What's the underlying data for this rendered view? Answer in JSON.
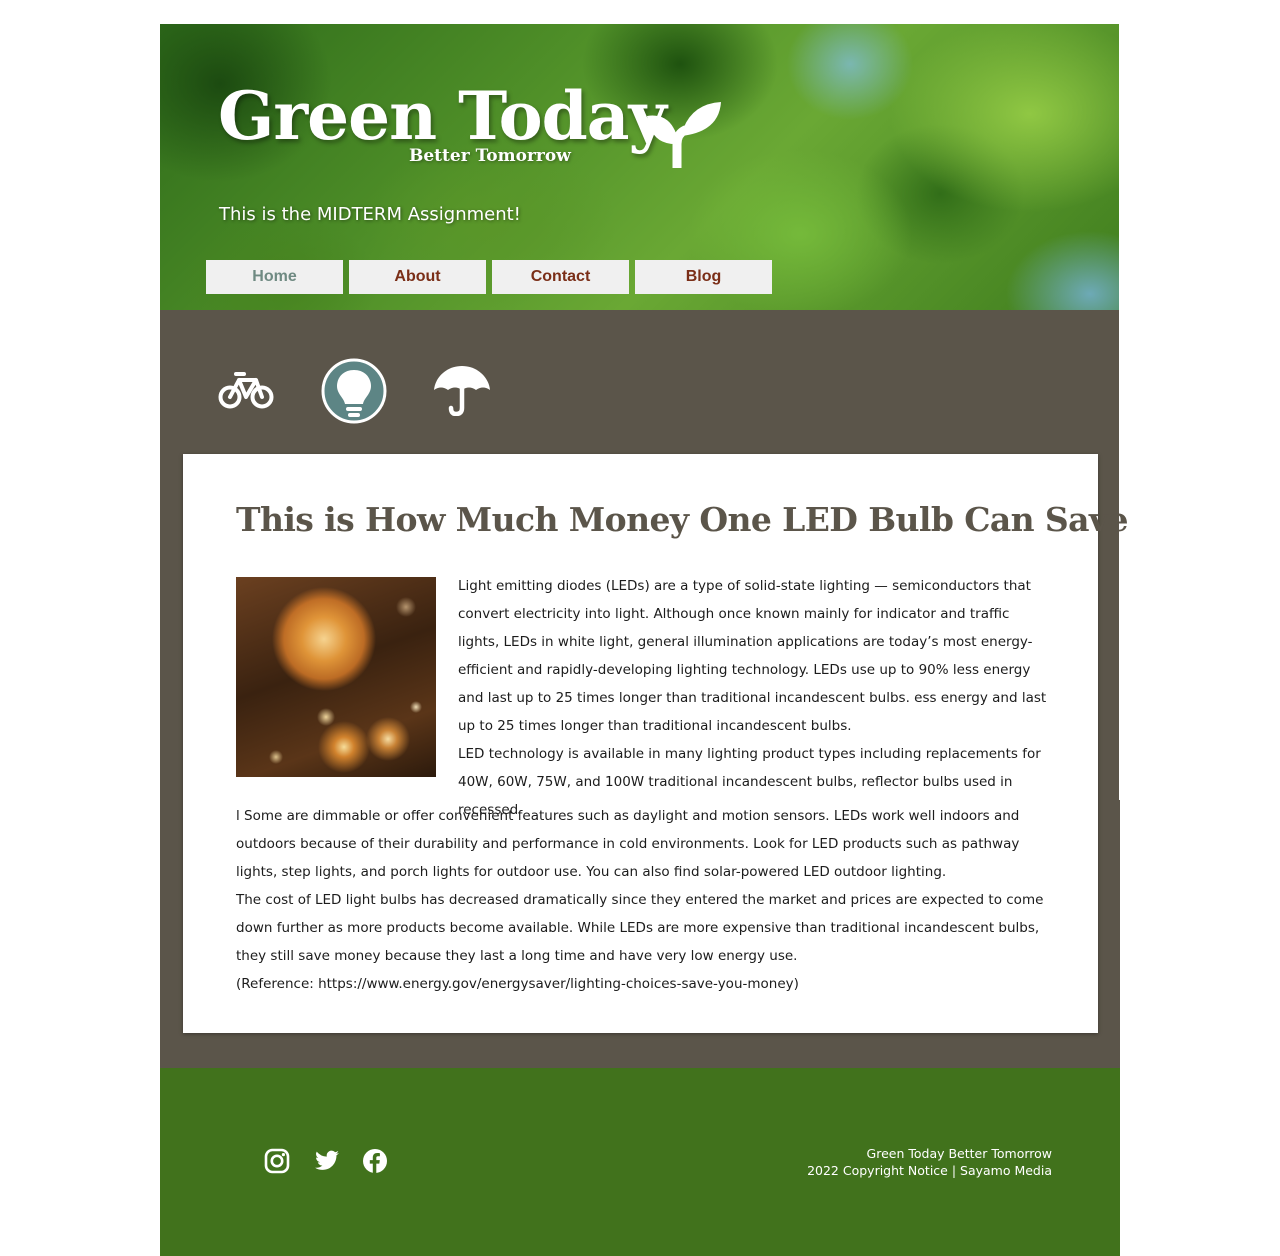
{
  "header": {
    "title": "Green Today",
    "subtitle": "Better Tomorrow",
    "tagline": "This is the MIDTERM Assignment!",
    "logo_icon": "sprout-icon"
  },
  "nav": {
    "items": [
      {
        "label": "Home",
        "active": true
      },
      {
        "label": "About",
        "active": false
      },
      {
        "label": "Contact",
        "active": false
      },
      {
        "label": "Blog",
        "active": false
      }
    ]
  },
  "feature_icons": [
    "bicycle-icon",
    "lightbulb-icon",
    "umbrella-icon"
  ],
  "article": {
    "title": "This is How Much Money One LED Bulb Can Save",
    "image_alt": "glowing vintage light bulbs",
    "paragraph_1": "Light emitting diodes (LEDs) are a type of solid-state lighting — semiconductors that convert electricity into light. Although once known mainly for indicator and traffic lights, LEDs in white light, general illumination applications are today’s most energy-efficient and rapidly-developing lighting technology. LEDs use up to 90% less energy and last up to 25 times longer than traditional incandescent bulbs. ess energy and last up to 25 times longer than traditional incandescent bulbs.",
    "paragraph_2": "LED technology is available in many lighting product types including replacements for 40W, 60W, 75W, and 100W traditional incandescent bulbs, reflector bulbs used in recessed",
    "paragraph_3": "l Some are dimmable or offer convenient features such as daylight and motion sensors. LEDs work well indoors and outdoors because of their durability and performance in cold environments. Look for LED products such as pathway lights, step lights, and porch lights for outdoor use. You can also find solar-powered LED outdoor lighting.",
    "paragraph_4": "The cost of LED light bulbs has decreased dramatically since they entered the market and prices are expected to come down further as more products become available. While LEDs are more expensive than traditional incandescent bulbs, they still save money because they last a long time and have very low energy use.",
    "reference": "(Reference: https://www.energy.gov/energysaver/lighting-choices-save-you-money)"
  },
  "footer": {
    "line_1": "Green Today Better Tomorrow",
    "line_2": "2022 Copyright Notice | Sayamo Media",
    "social_icons": [
      "instagram-icon",
      "twitter-icon",
      "facebook-icon"
    ]
  },
  "colors": {
    "band": "#5b554a",
    "footer": "#41721c",
    "nav_text": "#7a2e17",
    "nav_active": "#6f8a82",
    "heading": "#5b554a",
    "icon_highlight": "#5d8585"
  }
}
